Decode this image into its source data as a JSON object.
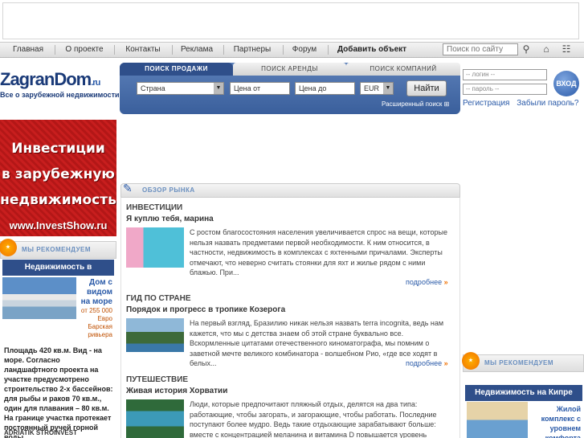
{
  "nav": {
    "items": [
      "Главная",
      "О проекте",
      "Контакты",
      "Реклама",
      "Партнеры",
      "Форум"
    ],
    "add_object": "Добавить объект",
    "search_placeholder": "Поиск по сайту"
  },
  "logo": {
    "name": "ZagranDom",
    "tld": ".ru",
    "tagline": "Все о зарубежной недвижимости"
  },
  "search": {
    "tabs": [
      "ПОИСК ПРОДАЖИ",
      "ПОИСК АРЕНДЫ",
      "ПОИСК КОМПАНИЙ"
    ],
    "country": "Страна",
    "price_from": "Цена от",
    "price_to": "Цена до",
    "currency": "EUR",
    "button": "Найти",
    "advanced": "Расширенный поиск"
  },
  "login": {
    "login_placeholder": "-- логин --",
    "password_placeholder": "-- пароль --",
    "enter_button": "ВХОД",
    "register": "Регистрация",
    "forgot": "Забыли пароль?"
  },
  "banner_left": {
    "lines": [
      "Инвестиции",
      "в зарубежную",
      "недвижимость"
    ],
    "site": "www.InvestShow.ru"
  },
  "recommend_left": {
    "header": "МЫ РЕКОМЕНДУЕМ",
    "title": "Недвижимость в Черногории",
    "item_title": "Дом с видом на море",
    "price": "от 255 000 Евро Барская ривьера",
    "description": "Площадь 420 кв.м. Вид - на море. Согласно ландшафтного проекта на участке предусмотрено строительство 2-х бассейнов: для рыбы и раков 70 кв.м., один для плавания – 80 кв.м. На границе участка протекает постоянный ручей горной воды",
    "company": "ADRIATIK STROINVEST"
  },
  "market": {
    "header": "ОБЗОР РЫНКА",
    "more_label": "подробнее",
    "sections": [
      {
        "category": "ИНВЕСТИЦИИ",
        "headline": "Я куплю тебя, марина",
        "text": "С ростом благосостояния населения увеличивается спрос на вещи, которые нельзя назвать предметами первой необходимости. К ним относится, в частности, недвижимость в комплексах с яхтенными причалами. Эксперты отмечают, что неверно считать стоянки для яхт и жилье рядом с ними блажью. При..."
      },
      {
        "category": "ГИД ПО СТРАНЕ",
        "headline": "Порядок и прогресс в тропике Козерога",
        "text": "На первый взгляд, Бразилию никак нельзя назвать terra incognita, ведь нам кажется, что мы с детства знаем об этой стране буквально все. Вскормленные цитатами отечественного киноматографа, мы помним о заветной мечте великого комбинатора - волшебном Рио, «где все ходят в белых..."
      },
      {
        "category": "ПУТЕШЕСТВИЕ",
        "headline": "Живая история Хорватии",
        "text": "Люди, которые предпочитают пляжный отдых, делятся на два типа: работающие, чтобы загорать, и загорающие, чтобы работать. Последние поступают более мудро. Ведь такие отдыхающие зарабатывают больше: вместе с концентрацией меланина и витамина D повышается уровень"
      }
    ]
  },
  "recommend_right": {
    "header": "МЫ РЕКОМЕНДУЕМ",
    "title": "Недвижимость на Кипре",
    "item_text": "Жилой комплекс с уровнем комфорта"
  }
}
